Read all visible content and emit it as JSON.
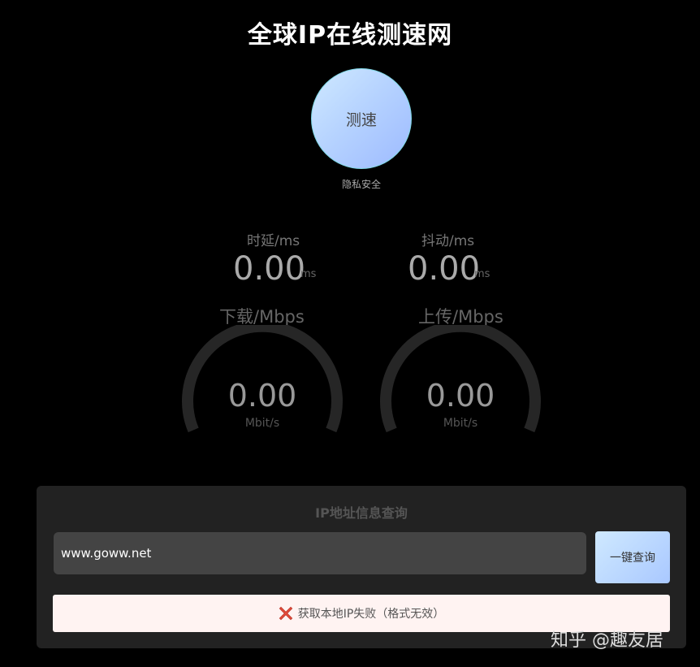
{
  "header": {
    "title": "全球IP在线测速网"
  },
  "speedtest": {
    "button_label": "测速",
    "privacy_text": "隐私安全"
  },
  "metrics": {
    "latency": {
      "label": "时延/ms",
      "value": "0.00",
      "unit": "ms"
    },
    "jitter": {
      "label": "抖动/ms",
      "value": "0.00",
      "unit": "ms"
    }
  },
  "gauges": {
    "download": {
      "label": "下载/Mbps",
      "value": "0.00",
      "unit": "Mbit/s"
    },
    "upload": {
      "label": "上传/Mbps",
      "value": "0.00",
      "unit": "Mbit/s"
    }
  },
  "ip_lookup": {
    "title": "IP地址信息查询",
    "input_value": "www.goww.net",
    "button_label": "一键查询",
    "error_text": "获取本地IP失败（格式无效）",
    "error_icon": "error-x-icon"
  },
  "watermark": {
    "text": "知乎 @趣友居"
  },
  "colors": {
    "background": "#000000",
    "panel": "#222222",
    "button_gradient_start": "#cfe9ff",
    "button_gradient_end": "#9dbaff",
    "error_bg": "#fff3f2",
    "error_icon": "#c0392b"
  }
}
